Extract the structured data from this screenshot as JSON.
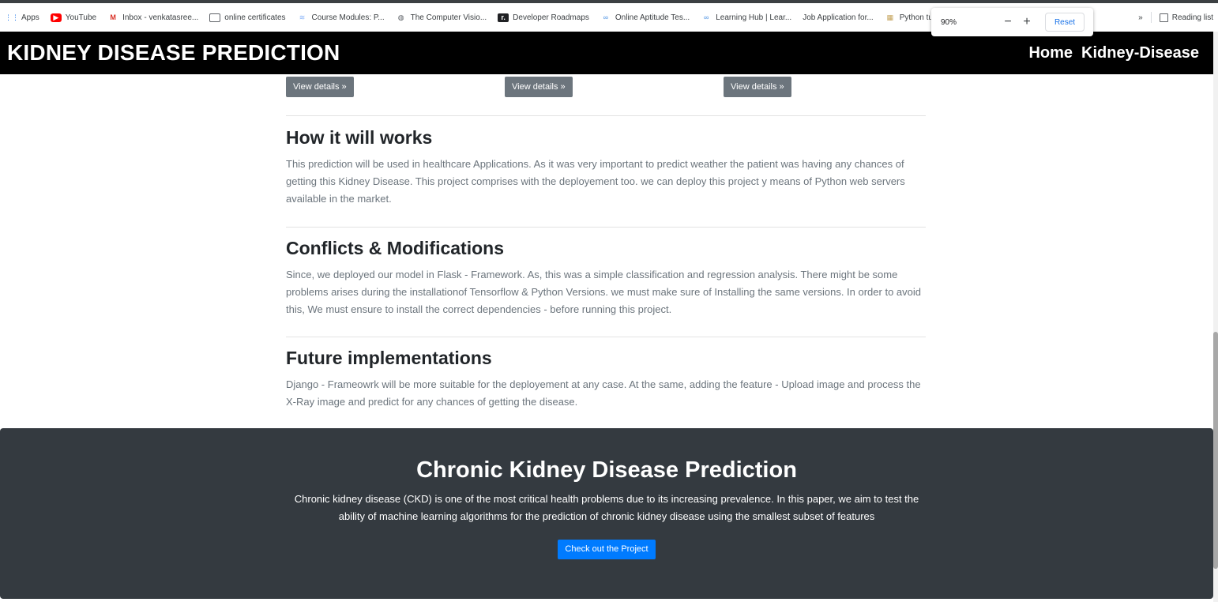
{
  "bookmarks": {
    "items": [
      {
        "label": "Apps",
        "icon": "apps-grid-icon"
      },
      {
        "label": "YouTube",
        "icon": "youtube-icon"
      },
      {
        "label": "Inbox - venkatasree...",
        "icon": "gmail-icon"
      },
      {
        "label": "online certificates",
        "icon": "certificate-icon"
      },
      {
        "label": "Course Modules: P...",
        "icon": "course-icon"
      },
      {
        "label": "The Computer Visio...",
        "icon": "globe-icon"
      },
      {
        "label": "Developer Roadmaps",
        "icon": "roadmap-icon"
      },
      {
        "label": "Online Aptitude Tes...",
        "icon": "infinity-icon"
      },
      {
        "label": "Learning Hub | Lear...",
        "icon": "infinity-icon"
      },
      {
        "label": "Job Application for...",
        "icon": ""
      },
      {
        "label": "Python tutori",
        "icon": "python-book-icon"
      }
    ],
    "overflow_label": "»",
    "reading_list_label": "Reading list"
  },
  "zoom_popup": {
    "value": "90%",
    "minus_label": "−",
    "plus_label": "+",
    "reset_label": "Reset"
  },
  "navbar": {
    "brand": "KIDNEY DISEASE PREDICTION",
    "links": [
      "Home",
      "Kidney-Disease"
    ]
  },
  "details_buttons": [
    "View details »",
    "View details »",
    "View details »"
  ],
  "sections": [
    {
      "title": "How it will works",
      "text": "This prediction will be used in healthcare Applications. As it was very important to predict weather the patient was having any chances of getting this Kidney Disease. This project comprises with the deployement too. we can deploy this project y means of Python web servers available in the market."
    },
    {
      "title": "Conflicts & Modifications",
      "text": "Since, we deployed our model in Flask - Framework. As, this was a simple classification and regression analysis. There might be some problems arises during the installationof Tensorflow & Python Versions. we must make sure of Installing the same versions. In order to avoid this, We must ensure to install the correct dependencies - before running this project."
    },
    {
      "title": "Future implementations",
      "text": "Django - Frameowrk will be more suitable for the deployement at any case. At the same, adding the feature - Upload image and process the X-Ray image and predict for any chances of getting the disease."
    }
  ],
  "footer": {
    "title": "Chronic Kidney Disease Prediction",
    "text": "Chronic kidney disease (CKD) is one of the most critical health problems due to its increasing prevalence. In this paper, we aim to test the ability of machine learning algorithms for the prediction of chronic kidney disease using the smallest subset of features",
    "button_label": "Check out the Project"
  },
  "colors": {
    "navbar_bg": "#000000",
    "footer_bg": "#343a40",
    "secondary_button": "#6c757d",
    "primary_button": "#007bff"
  }
}
